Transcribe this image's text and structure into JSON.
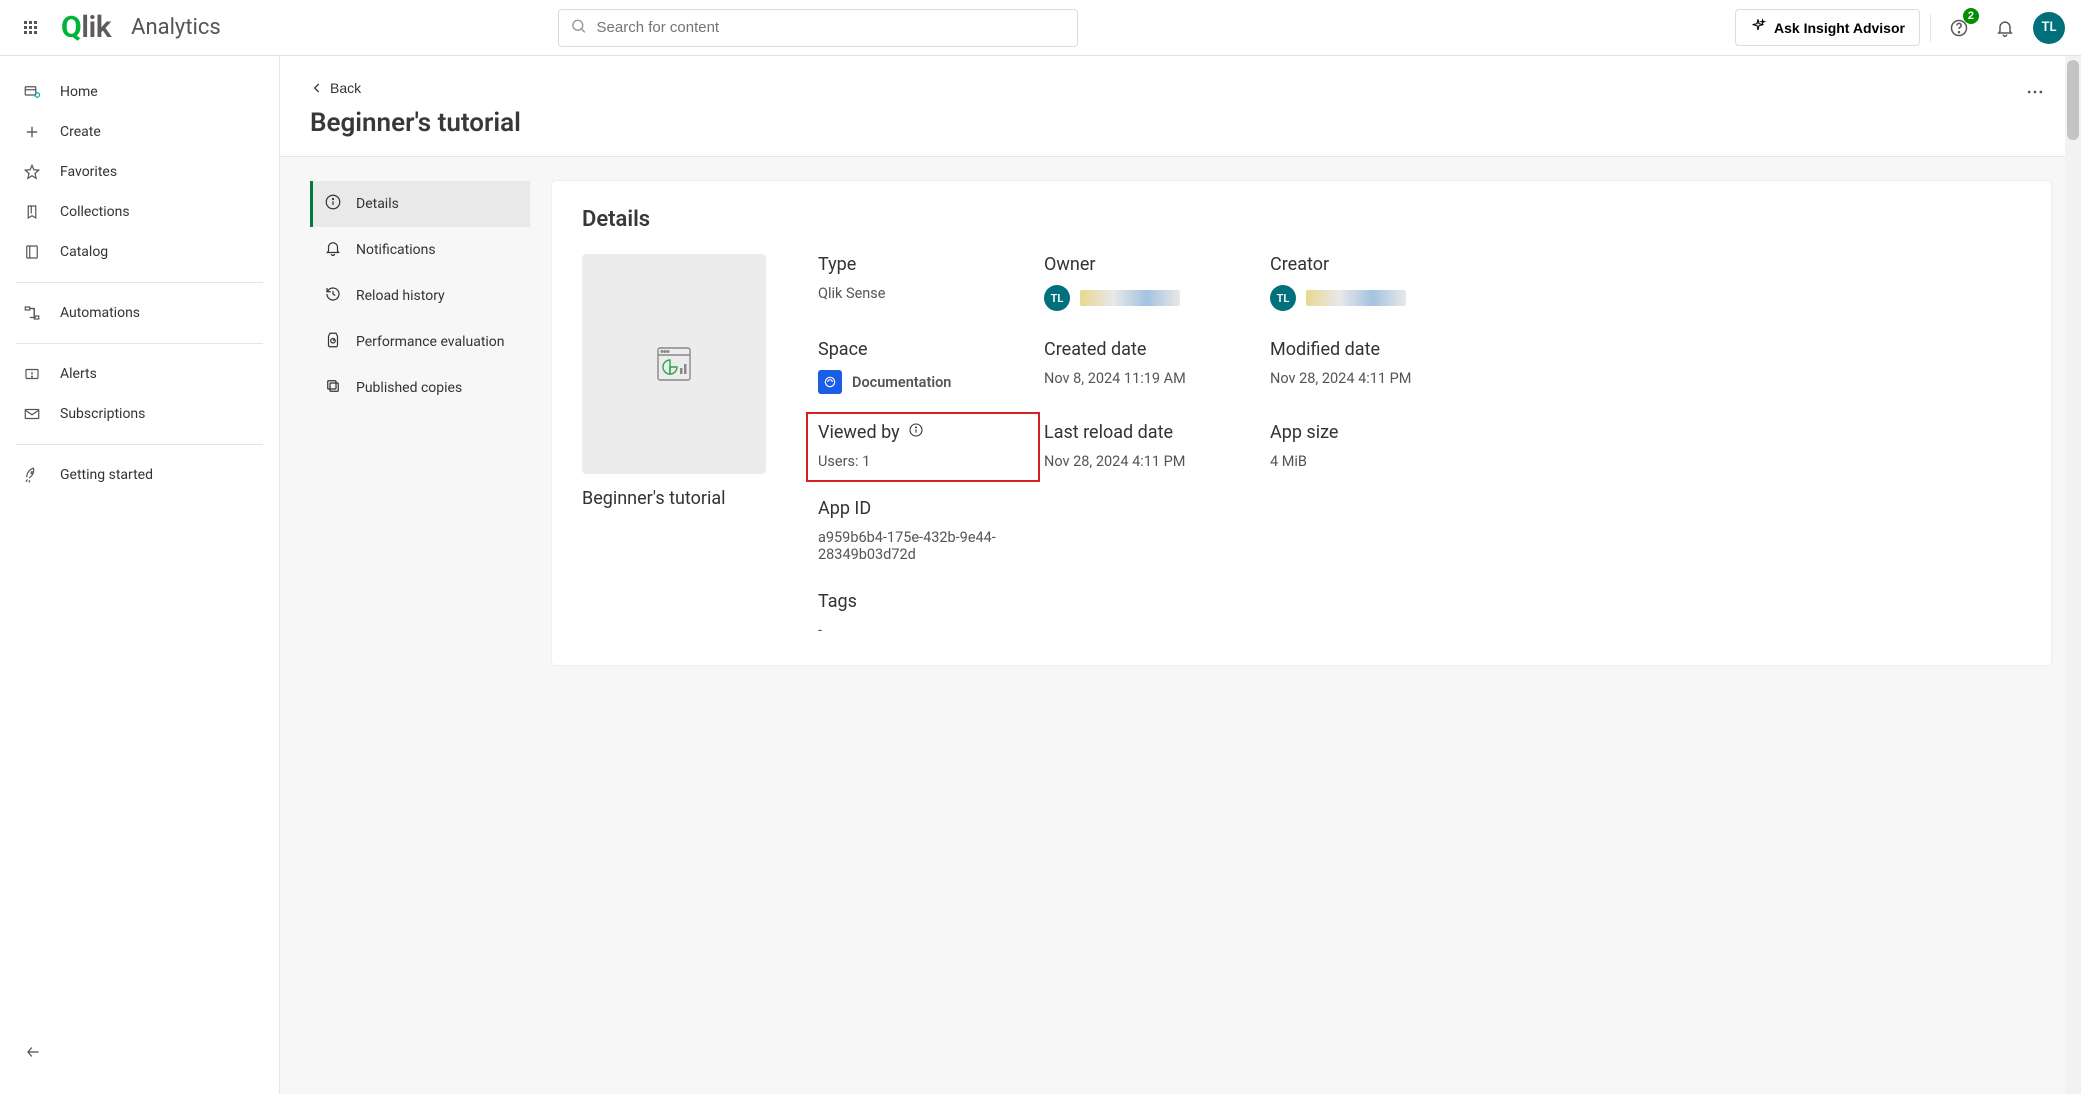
{
  "header": {
    "brand": "Qlik",
    "sub": "Analytics",
    "search_placeholder": "Search for content",
    "ask_advisor": "Ask Insight Advisor",
    "notif_count": "2",
    "avatar_initials": "TL"
  },
  "sidebar": {
    "items": [
      {
        "label": "Home"
      },
      {
        "label": "Create"
      },
      {
        "label": "Favorites"
      },
      {
        "label": "Collections"
      },
      {
        "label": "Catalog"
      },
      {
        "label": "Automations"
      },
      {
        "label": "Alerts"
      },
      {
        "label": "Subscriptions"
      },
      {
        "label": "Getting started"
      }
    ]
  },
  "page": {
    "back": "Back",
    "title": "Beginner's tutorial"
  },
  "subnav": {
    "items": [
      {
        "label": "Details"
      },
      {
        "label": "Notifications"
      },
      {
        "label": "Reload history"
      },
      {
        "label": "Performance evaluation"
      },
      {
        "label": "Published copies"
      }
    ]
  },
  "panel": {
    "title": "Details",
    "thumb_title": "Beginner's tutorial",
    "meta": {
      "type_label": "Type",
      "type_value": "Qlik Sense",
      "owner_label": "Owner",
      "owner_initials": "TL",
      "creator_label": "Creator",
      "creator_initials": "TL",
      "space_label": "Space",
      "space_value": "Documentation",
      "created_label": "Created date",
      "created_value": "Nov 8, 2024 11:19 AM",
      "modified_label": "Modified date",
      "modified_value": "Nov 28, 2024 4:11 PM",
      "viewed_label": "Viewed by",
      "viewed_value": "Users: 1",
      "reload_label": "Last reload date",
      "reload_value": "Nov 28, 2024 4:11 PM",
      "size_label": "App size",
      "size_value": "4 MiB",
      "appid_label": "App ID",
      "appid_value": "a959b6b4-175e-432b-9e44-28349b03d72d",
      "tags_label": "Tags",
      "tags_value": "-"
    }
  }
}
